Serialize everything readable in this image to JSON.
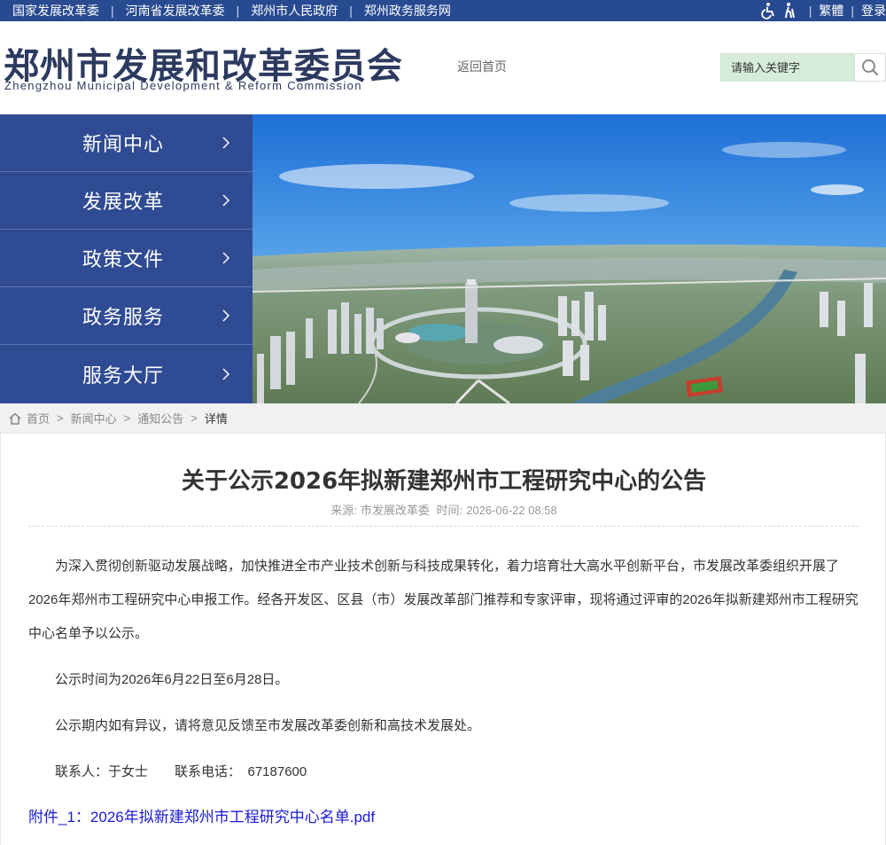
{
  "topbar": {
    "links": [
      "国家发展改革委",
      "河南省发展改革委",
      "郑州市人民政府",
      "郑州政务服务网"
    ],
    "accessibility_icons": [
      "wheelchair-icon",
      "elderly-icon"
    ],
    "traditional_label": "繁體",
    "login_label": "登录"
  },
  "header": {
    "logo_cn": "郑州市发展和改革委员会",
    "logo_en": "Zhengzhou Municipal Development & Reform Commission",
    "home_link": "返回首页",
    "search_placeholder": "请输入关键字"
  },
  "nav": {
    "items": [
      {
        "label": "新闻中心"
      },
      {
        "label": "发展改革"
      },
      {
        "label": "政策文件"
      },
      {
        "label": "政务服务"
      },
      {
        "label": "服务大厅"
      }
    ]
  },
  "breadcrumb": {
    "items": [
      "首页",
      "新闻中心",
      "通知公告"
    ],
    "current": "详情"
  },
  "article": {
    "title": "关于公示2026年拟新建郑州市工程研究中心的公告",
    "source_label": "来源:",
    "source": "市发展改革委",
    "time_label": "时间:",
    "time": "2026-06-22 08:58",
    "paragraphs": [
      "为深入贯彻创新驱动发展战略，加快推进全市产业技术创新与科技成果转化，着力培育壮大高水平创新平台，市发展改革委组织开展了2026年郑州市工程研究中心申报工作。经各开发区、区县（市）发展改革部门推荐和专家评审，现将通过评审的2026年拟新建郑州市工程研究中心名单予以公示。",
      "公示时间为2026年6月22日至6月28日。",
      "公示期内如有异议，请将意见反馈至市发展改革委创新和高技术发展处。",
      "联系人：于女士　　联系电话：　67187600"
    ],
    "attachment": "附件_1：2026年拟新建郑州市工程研究中心名单.pdf"
  },
  "colors": {
    "primary": "#284a91",
    "nav_bg": "#2f4b93",
    "search_bg": "#d5ecd9",
    "link": "#1a1ad6"
  }
}
